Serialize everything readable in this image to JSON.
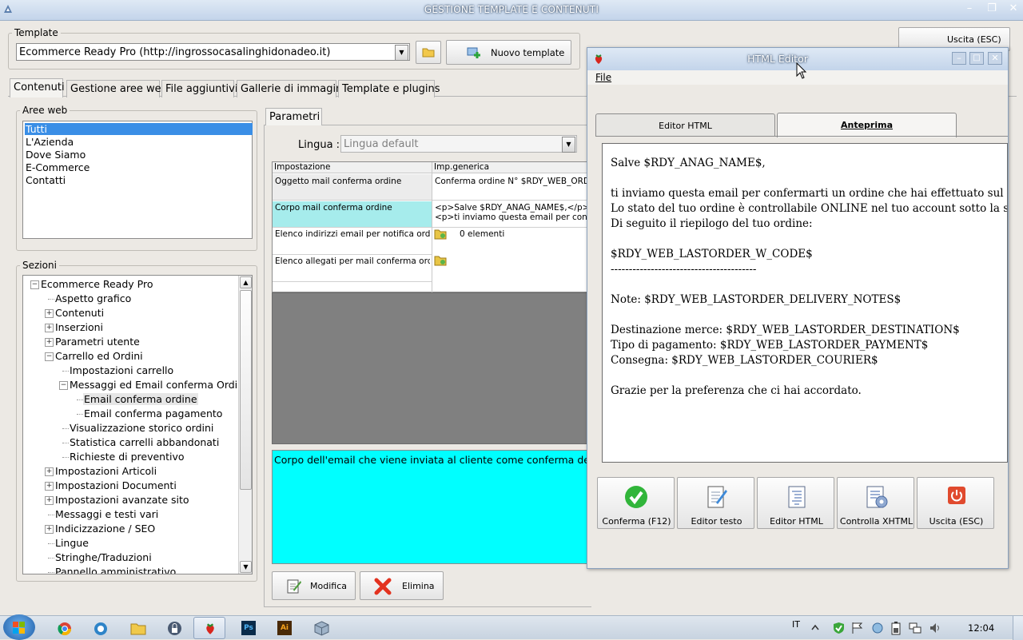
{
  "window": {
    "title": "GESTIONE TEMPLATE E CONTENUTI",
    "minimize": "–",
    "maximize": "❐",
    "close": "✕"
  },
  "template": {
    "legend": "Template",
    "selected": "Ecommerce Ready Pro (http://ingrossocasalinghidonadeo.it)",
    "new_button": "Nuovo template"
  },
  "main_tabs": [
    "Contenuti",
    "Gestione aree web",
    "File aggiuntivi",
    "Gallerie di immagini",
    "Template e plugins"
  ],
  "aree_web": {
    "legend": "Aree web",
    "items": [
      "Tutti",
      "L'Azienda",
      "Dove Siamo",
      "E-Commerce",
      "Contatti"
    ]
  },
  "sezioni": {
    "legend": "Sezioni",
    "tree": [
      {
        "label": "Ecommerce Ready Pro",
        "expander": "−"
      },
      {
        "label": "Aspetto grafico",
        "expander": ""
      },
      {
        "label": "Contenuti",
        "expander": "+"
      },
      {
        "label": "Inserzioni",
        "expander": "+"
      },
      {
        "label": "Parametri utente",
        "expander": "+"
      },
      {
        "label": "Carrello ed Ordini",
        "expander": "−"
      },
      {
        "label": "Impostazioni carrello",
        "expander": ""
      },
      {
        "label": "Messaggi ed Email conferma Ordine",
        "expander": "−"
      },
      {
        "label": "Email conferma ordine",
        "expander": ""
      },
      {
        "label": "Email conferma pagamento",
        "expander": ""
      },
      {
        "label": "Visualizzazione storico ordini",
        "expander": ""
      },
      {
        "label": "Statistica carrelli abbandonati",
        "expander": ""
      },
      {
        "label": "Richieste di preventivo",
        "expander": ""
      },
      {
        "label": "Impostazioni Articoli",
        "expander": "+"
      },
      {
        "label": "Impostazioni Documenti",
        "expander": "+"
      },
      {
        "label": "Impostazioni avanzate sito",
        "expander": "+"
      },
      {
        "label": "Messaggi e testi vari",
        "expander": ""
      },
      {
        "label": "Indicizzazione / SEO",
        "expander": "+"
      },
      {
        "label": "Lingue",
        "expander": ""
      },
      {
        "label": "Stringhe/Traduzioni",
        "expander": ""
      },
      {
        "label": "Pannello amministrativo",
        "expander": ""
      }
    ]
  },
  "parametri": {
    "tab": "Parametri",
    "lingua_label": "Lingua :",
    "lingua_value": "Lingua default",
    "columns": [
      "Impostazione",
      "Imp.generica"
    ],
    "rows": [
      {
        "name": "Oggetto mail conferma ordine",
        "value": "Conferma ordine N° $RDY_WEB_ORDER",
        "value2": ""
      },
      {
        "name": "Corpo mail conferma ordine",
        "value": "<p>Salve $RDY_ANAG_NAME$,</p>",
        "value2": "<p>ti inviamo questa email per conferm"
      },
      {
        "name": "Elenco indirizzi email per notifica ordine",
        "value": "0 elementi",
        "value2": ""
      },
      {
        "name": "Elenco allegati per mail conferma ordine",
        "value": "",
        "value2": ""
      }
    ],
    "description": "Corpo dell'email che viene inviata al cliente come conferma dell'ordin",
    "modifica": "Modifica",
    "elimina": "Elimina"
  },
  "behind_button": "Uscita (ESC)",
  "editor": {
    "title": "HTML Editor",
    "menu_file": "File",
    "tabs": [
      "Editor HTML",
      "Anteprima"
    ],
    "preview_lines": [
      "Salve $RDY_ANAG_NAME$,",
      "ti inviamo questa email per confermarti un ordine che hai effettuato sul nostro sito in",
      "Lo stato del tuo ordine è controllabile ONLINE nel tuo account sotto la sezione O",
      "Di seguito il riepilogo del tuo ordine:",
      "$RDY_WEB_LASTORDER_W_CODE$",
      "----------------------------------------",
      "Note: $RDY_WEB_LASTORDER_DELIVERY_NOTES$",
      "Destinazione merce: $RDY_WEB_LASTORDER_DESTINATION$",
      "Tipo di pagamento: $RDY_WEB_LASTORDER_PAYMENT$",
      "Consegna: $RDY_WEB_LASTORDER_COURIER$",
      "Grazie per la preferenza che ci hai accordato."
    ],
    "buttons": [
      "Conferma (F12)",
      "Editor testo",
      "Editor HTML",
      "Controlla XHTML",
      "Uscita (ESC)"
    ]
  },
  "taskbar": {
    "lang": "IT",
    "clock": "12:04"
  }
}
